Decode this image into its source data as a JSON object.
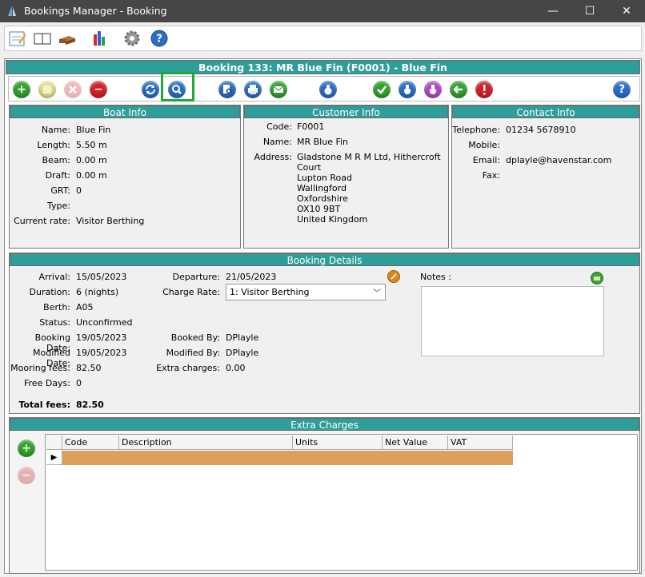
{
  "window": {
    "title": "Bookings Manager - Booking",
    "minimize": "—",
    "maximize": "☐",
    "close": "✕"
  },
  "toolbar_icons": [
    "notepad-icon",
    "book-icon",
    "bed-icon",
    "bar-chart-icon",
    "gear-icon",
    "help-icon"
  ],
  "booking_header": "Booking 133: MR Blue Fin (F0001) - Blue Fin",
  "actions": {
    "add": "+",
    "remove": "−",
    "help": "?"
  },
  "boat_info": {
    "title": "Boat Info",
    "fields": [
      {
        "label": "Name:",
        "value": "Blue Fin"
      },
      {
        "label": "Length:",
        "value": "5.50 m"
      },
      {
        "label": "Beam:",
        "value": "0.00 m"
      },
      {
        "label": "Draft:",
        "value": "0.00 m"
      },
      {
        "label": "GRT:",
        "value": "0"
      },
      {
        "label": "Type:",
        "value": ""
      },
      {
        "label": "Current rate:",
        "value": "Visitor Berthing"
      }
    ]
  },
  "customer_info": {
    "title": "Customer Info",
    "code_label": "Code:",
    "code": "F0001",
    "name_label": "Name:",
    "name": "MR Blue Fin",
    "address_label": "Address:",
    "address_lines": [
      "Gladstone M R M Ltd, Hithercroft",
      "Court",
      "Lupton Road",
      "Wallingford",
      "Oxfordshire",
      "OX10 9BT",
      "United Kingdom"
    ]
  },
  "contact_info": {
    "title": "Contact Info",
    "fields": [
      {
        "label": "Telephone:",
        "value": "01234 5678910"
      },
      {
        "label": "Mobile:",
        "value": ""
      },
      {
        "label": "Email:",
        "value": "dplayle@havenstar.com"
      },
      {
        "label": "Fax:",
        "value": ""
      }
    ]
  },
  "booking_details": {
    "title": "Booking Details",
    "left": [
      {
        "label": "Arrival:",
        "value": "15/05/2023"
      },
      {
        "label": "Duration:",
        "value": "6 (nights)"
      },
      {
        "label": "Berth:",
        "value": "A05"
      },
      {
        "label": "Status:",
        "value": "Unconfirmed"
      },
      {
        "label": "Booking Date:",
        "value": "19/05/2023"
      },
      {
        "label": "Modified Date:",
        "value": "19/05/2023"
      },
      {
        "label": "Mooring fees:",
        "value": "82.50"
      },
      {
        "label": "Free Days:",
        "value": "0"
      }
    ],
    "departure_label": "Departure:",
    "departure": "21/05/2023",
    "charge_rate_label": "Charge Rate:",
    "charge_rate": "1: Visitor Berthing",
    "booked_by_label": "Booked By:",
    "booked_by": "DPlayle",
    "modified_by_label": "Modified By:",
    "modified_by": "DPlayle",
    "extra_charges_label": "Extra charges:",
    "extra_charges": "0.00",
    "total_fees_label": "Total fees:",
    "total_fees": "82.50",
    "notes_label": "Notes :"
  },
  "extra_charges": {
    "title": "Extra Charges",
    "columns": [
      "Code",
      "Description",
      "Units",
      "Net Value",
      "VAT"
    ],
    "row_marker": "▶"
  }
}
